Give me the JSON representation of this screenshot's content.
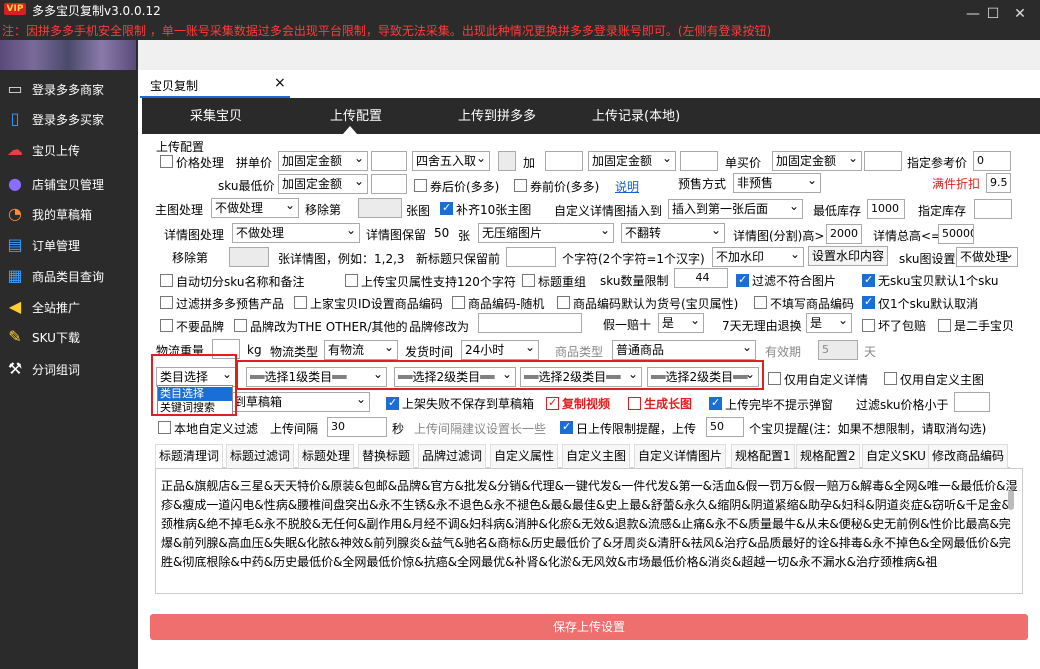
{
  "app": {
    "badge": "VIP",
    "title": "多多宝贝复制v3.0.0.12",
    "notice": "注：因拼多多手机安全限制 ，单一账号采集数据过多会出现平台限制，导致无法采集。出现此种情况更换拼多多登录账号即可。(左侧有登录按钮)",
    "window_controls": [
      "minimize-icon",
      "maximize-icon",
      "close-icon"
    ]
  },
  "sidebar": {
    "items": [
      {
        "icon": "monitor-icon",
        "label": "登录多多商家"
      },
      {
        "icon": "phone-icon",
        "label": "登录多多买家"
      },
      {
        "icon": "cloud-upload-icon",
        "label": "宝贝上传"
      },
      {
        "icon": "user-icon",
        "label": "店铺宝贝管理"
      },
      {
        "icon": "pie-chart-icon",
        "label": "我的草稿箱"
      },
      {
        "icon": "cart-icon",
        "label": "订单管理"
      },
      {
        "icon": "grid-icon",
        "label": "商品类目查询"
      },
      {
        "icon": "megaphone-icon",
        "label": "全站推广"
      },
      {
        "icon": "sku-icon",
        "label": "SKU下载"
      },
      {
        "icon": "hammer-icon",
        "label": "分词组词"
      }
    ]
  },
  "main": {
    "tab": {
      "label": "宝贝复制",
      "close": "×"
    },
    "nav": [
      "采集宝贝",
      "上传配置",
      "上传到拼多多",
      "上传记录(本地)"
    ],
    "active_nav": "上传配置"
  },
  "config": {
    "section_title": "上传配置",
    "row1": {
      "price_process": "价格处理",
      "single_buy_price": "拼单价",
      "sel1": "加固定金额",
      "input1": "",
      "round": "四舍五入取",
      "add": "加",
      "sel2": "加固定金额",
      "single_price": "单买价",
      "sel3": "加固定金额",
      "ref_price": "指定参考价",
      "ref_val": "0"
    },
    "row2": {
      "sku_min": "sku最低价",
      "sel": "加固定金额",
      "after_coupon": "券后价(多多)",
      "before_coupon": "券前价(多多)",
      "explain": "说明",
      "presale_label": "预售方式",
      "presale": "非预售",
      "discount": "满件折扣",
      "discount_val": "9.5"
    },
    "row3": {
      "main_img": "主图处理",
      "main_sel": "不做处理",
      "remove_nth": "移除第",
      "img_unit": "张图",
      "fill10": "补齐10张主图",
      "custom_detail": "自定义详情图插入到",
      "insert_sel": "插入到第一张后面",
      "min_stock": "最低库存",
      "min_stock_val": "1000",
      "set_stock": "指定库存"
    },
    "row4": {
      "detail_img": "详情图处理",
      "detail_sel": "不做处理",
      "detail_keep": "详情图保留",
      "keep_val": "50",
      "unit": "张",
      "no_compress": "无压缩图片",
      "no_flip": "不翻转",
      "split_height": "详情图(分割)高>",
      "split_val": "2000",
      "total_height": "详情总高<=",
      "total_val": "50000"
    },
    "row5": {
      "remove_nth": "移除第",
      "detail_example": "张详情图，例如：1,2,3",
      "title_keep": "新标题只保留前",
      "char_note": "个字符(2个字符=1个汉字)",
      "watermark_sel": "不加水印",
      "watermark_btn": "设置水印内容",
      "sku_img": "sku图设置",
      "sku_img_sel": "不做处理"
    },
    "row6": {
      "auto_split": "自动切分sku名称和备注",
      "attr120": "上传宝贝属性支持120个字符",
      "title_regroup": "标题重组",
      "sku_limit": "sku数量限制",
      "sku_limit_val": "44",
      "filter_bad": "过滤不符合图片",
      "no_sku_default": "无sku宝贝默认1个sku"
    },
    "row7": {
      "filter_presale": "过滤拼多多预售产品",
      "set_code": "上家宝贝ID设置商品编码",
      "random_code": "商品编码-随机",
      "code_as_sku": "商品编码默认为货号(宝贝属性)",
      "no_fill_code": "不填写商品编码",
      "one_sku_cancel": "仅1个sku默认取消"
    },
    "row8": {
      "no_brand": "不要品牌",
      "brand_other": "品牌改为THE OTHER/其他的",
      "brand_modify": "品牌修改为",
      "fake_ten": "假一赔十",
      "fake_sel": "是",
      "seven_days": "7天无理由退换",
      "seven_sel": "是",
      "bad_pay": "坏了包赔",
      "second_hand": "是二手宝贝"
    },
    "row9": {
      "logistics_weight": "物流重量",
      "kg": "kg",
      "logistics_type": "物流类型",
      "logistics_sel": "有物流",
      "ship_time": "发货时间",
      "ship_sel": "24小时",
      "goods_type": "商品类型",
      "goods_sel": "普通商品",
      "valid_period": "有效期",
      "valid_val": "5",
      "day": "天"
    },
    "row10": {
      "category_sel": "类目选择",
      "category_options": [
        "类目选择",
        "关键词搜索"
      ],
      "level1": "══选择1级类目══",
      "level2a": "══选择2级类目══",
      "level2b": "══选择2级类目══",
      "level2c": "══选择2级类目══",
      "only_custom_detail": "仅用自定义详情",
      "only_custom_main": "仅用自定义主图"
    },
    "row11": {
      "upload_to": "到草稿箱",
      "no_save_draft": "上架失败不保存到草稿箱",
      "copy_video": "复制视频",
      "gen_long": "生成长图",
      "no_popup": "上传完毕不提示弹窗",
      "filter_sku_price": "过滤sku价格小于"
    },
    "row12": {
      "local_filter": "本地自定义过滤",
      "upload_interval": "上传间隔",
      "interval_val": "30",
      "sec": "秒",
      "interval_tip": "上传间隔建议设置长一些",
      "daily_limit": "日上传限制提醒，上传",
      "limit_val": "50",
      "limit_tip": "个宝贝提醒(注：如果不想限制，请取消勾选)"
    },
    "subtabs": [
      "标题清理词",
      "标题过滤词",
      "标题处理",
      "替换标题",
      "品牌过滤词",
      "自定义属性",
      "自定义主图",
      "自定义详情图片",
      "规格配置1",
      "规格配置2",
      "自定义SKU",
      "修改商品编码"
    ],
    "cleanup_words": "正品&旗舰店&三星&天天特价&原装&包邮&品牌&官方&批发&分销&代理&一键代发&一件代发&第一&活血&假一罚万&假一赔万&解毒&全网&唯一&最低价&湿疹&瘦成一道闪电&性病&腰椎间盘突出&永不生锈&永不退色&永不褪色&最&最佳&史上最&舒蕾&永久&缩阴&阴道紧缩&助孕&妇科&阴道炎症&窃听&千足金&颈椎病&绝不掉毛&永不脱胶&无任何&副作用&月经不调&妇科病&消肿&化瘀&无效&退款&流感&止痛&永不&质量最牛&从未&便秘&史无前例&性价比最高&完爆&前列腺&高血压&失眠&化脓&神效&前列腺炎&益气&驰名&商标&历史最低价了&牙周炎&清肝&祛风&治疗&品质最好的诠&排毒&永不掉色&全网最低价&完胜&彻底根除&中药&历史最低价&全网最低价惊&抗癌&全网最优&补肾&化淤&无风效&市场最低价格&消炎&超越一切&永不漏水&治疗颈椎病&祖",
    "save_button": "保存上传设置"
  }
}
